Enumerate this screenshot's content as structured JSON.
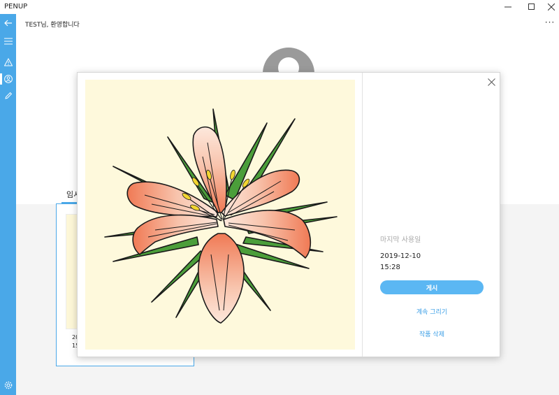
{
  "app": {
    "title": "PENUP"
  },
  "window_controls": [
    "minimize-icon",
    "maximize-icon",
    "close-icon"
  ],
  "header": {
    "greeting": "TEST님, 환영합니다",
    "more_label": "···"
  },
  "rail": {
    "items": [
      "back-arrow-icon",
      "hamburger-menu-icon",
      "warning-triangle-icon",
      "profile-icon",
      "pencil-icon"
    ],
    "active": "profile-icon",
    "bottom": "settings-icon"
  },
  "profile": {
    "tab_label": "임시",
    "card": {
      "date": "20",
      "time": "15"
    }
  },
  "dialog": {
    "last_used_label": "마지막 사용일",
    "date": "2019-12-10",
    "time": "15:28",
    "post_button": "게시",
    "continue_button": "계속 그리기",
    "delete_button": "작품 삭제"
  },
  "colors": {
    "accent": "#4aa8e8",
    "button": "#5bb7f3",
    "link": "#3a9ee6",
    "canvas_bg": "#fef9dc",
    "petal": "#f08a68",
    "leaf": "#4b9e3a"
  }
}
